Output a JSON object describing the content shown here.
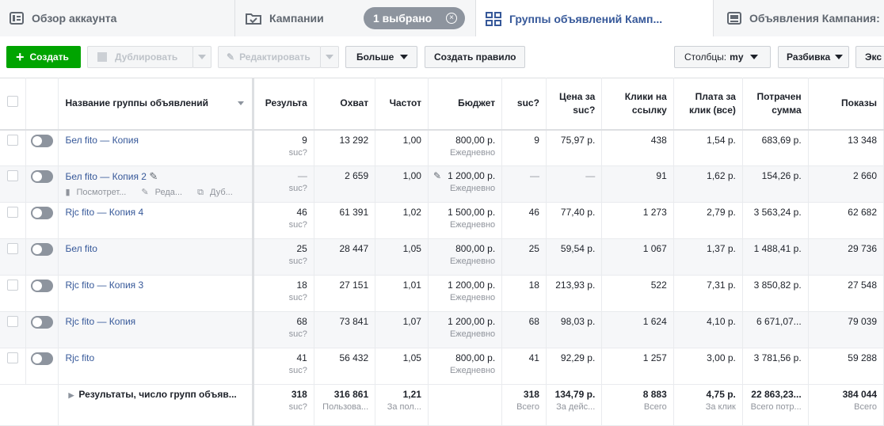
{
  "tabs": {
    "overview": "Обзор аккаунта",
    "campaigns": "Кампании",
    "selected": "1 выбрано",
    "adsets": "Группы объявлений Камп...",
    "ads": "Объявления Кампания:"
  },
  "toolbar": {
    "create": "Создать",
    "duplicate": "Дублировать",
    "edit": "Редактировать",
    "more": "Больше",
    "create_rule": "Создать правило",
    "columns_label": "Столбцы:",
    "columns_value": "my",
    "breakdown": "Разбивка",
    "export": "Экс"
  },
  "columns": {
    "name": "Название группы объявлений",
    "results": "Результа",
    "reach": "Охват",
    "frequency": "Частот",
    "budget": "Бюджет",
    "suc": "suc?",
    "cost_suc": "Цена за suc?",
    "link_clicks": "Клики на ссылку",
    "cpc": "Плата за клик (все)",
    "spent": "Потрачен сумма",
    "impressions": "Показы"
  },
  "rows": [
    {
      "name": "Бел fito — Копия",
      "results": "9",
      "results_sub": "suc?",
      "reach": "13 292",
      "frequency": "1,00",
      "budget": "800,00 р.",
      "budget_sub": "Ежедневно",
      "suc": "9",
      "cost_suc": "75,97 р.",
      "link_clicks": "438",
      "cpc": "1,54 р.",
      "spent": "683,69 р.",
      "impressions": "13 348"
    },
    {
      "name": "Бел fito — Копия 2",
      "results": "—",
      "results_sub": "suc?",
      "reach": "2 659",
      "frequency": "1,00",
      "budget": "1 200,00 р.",
      "budget_sub": "Ежедневно",
      "suc": "—",
      "cost_suc": "—",
      "link_clicks": "91",
      "cpc": "1,62 р.",
      "spent": "154,26 р.",
      "impressions": "2 660",
      "view": "Посмотрет...",
      "edit": "Реда...",
      "dup": "Дуб..."
    },
    {
      "name": "Rjc fito — Копия 4",
      "results": "46",
      "results_sub": "suc?",
      "reach": "61 391",
      "frequency": "1,02",
      "budget": "1 500,00 р.",
      "budget_sub": "Ежедневно",
      "suc": "46",
      "cost_suc": "77,40 р.",
      "link_clicks": "1 273",
      "cpc": "2,79 р.",
      "spent": "3 563,24 р.",
      "impressions": "62 682"
    },
    {
      "name": "Бел fito",
      "results": "25",
      "results_sub": "suc?",
      "reach": "28 447",
      "frequency": "1,05",
      "budget": "800,00 р.",
      "budget_sub": "Ежедневно",
      "suc": "25",
      "cost_suc": "59,54 р.",
      "link_clicks": "1 067",
      "cpc": "1,37 р.",
      "spent": "1 488,41 р.",
      "impressions": "29 736"
    },
    {
      "name": "Rjc fito — Копия 3",
      "results": "18",
      "results_sub": "suc?",
      "reach": "27 151",
      "frequency": "1,01",
      "budget": "1 200,00 р.",
      "budget_sub": "Ежедневно",
      "suc": "18",
      "cost_suc": "213,93 р.",
      "link_clicks": "522",
      "cpc": "7,31 р.",
      "spent": "3 850,82 р.",
      "impressions": "27 548"
    },
    {
      "name": "Rjc fito — Копия",
      "results": "68",
      "results_sub": "suc?",
      "reach": "73 841",
      "frequency": "1,07",
      "budget": "1 200,00 р.",
      "budget_sub": "Ежедневно",
      "suc": "68",
      "cost_suc": "98,03 р.",
      "link_clicks": "1 624",
      "cpc": "4,10 р.",
      "spent": "6 671,07...",
      "impressions": "79 039"
    },
    {
      "name": "Rjc fito",
      "results": "41",
      "results_sub": "suc?",
      "reach": "56 432",
      "frequency": "1,05",
      "budget": "800,00 р.",
      "budget_sub": "Ежедневно",
      "suc": "41",
      "cost_suc": "92,29 р.",
      "link_clicks": "1 257",
      "cpc": "3,00 р.",
      "spent": "3 781,56 р.",
      "impressions": "59 288"
    }
  ],
  "totals": {
    "label": "Результаты, число групп объяв...",
    "results": "318",
    "results_sub": "suc?",
    "reach": "316 861",
    "reach_sub": "Пользова...",
    "frequency": "1,21",
    "frequency_sub": "За пол...",
    "suc": "318",
    "suc_sub": "Всего",
    "cost_suc": "134,79 р.",
    "cost_suc_sub": "За дейс...",
    "link_clicks": "8 883",
    "link_clicks_sub": "Всего",
    "cpc": "4,75 р.",
    "cpc_sub": "За клик",
    "spent": "22 863,23...",
    "spent_sub": "Всего потр...",
    "impressions": "384 044",
    "impressions_sub": "Всего"
  },
  "colors": {
    "accent": "#365899",
    "create": "#00a400"
  }
}
